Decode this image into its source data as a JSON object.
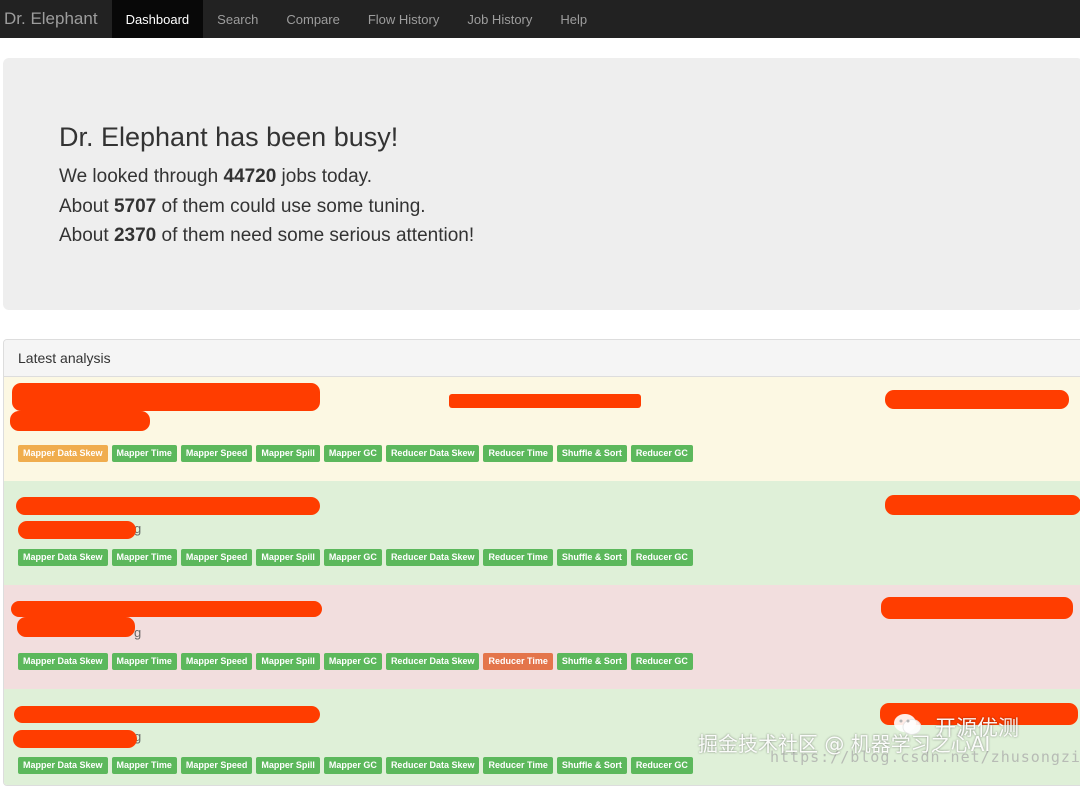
{
  "nav": {
    "brand": "Dr. Elephant",
    "items": [
      "Dashboard",
      "Search",
      "Compare",
      "Flow History",
      "Job History",
      "Help"
    ],
    "active": "Dashboard"
  },
  "jumbotron": {
    "title": "Dr. Elephant has been busy!",
    "line1": {
      "pre": "We looked through ",
      "num": "44720",
      "post": " jobs today."
    },
    "line2": {
      "pre": "About ",
      "num": "5707",
      "post": " of them could use some tuning."
    },
    "line3": {
      "pre": "About ",
      "num": "2370",
      "post": " of them need some serious attention!"
    }
  },
  "panel": {
    "heading": "Latest analysis",
    "rows": [
      {
        "status": "warning",
        "trailing_text": "",
        "badges": [
          {
            "label": "Mapper Data Skew",
            "severity": "moderate"
          },
          {
            "label": "Mapper Time",
            "severity": "none"
          },
          {
            "label": "Mapper Speed",
            "severity": "none"
          },
          {
            "label": "Mapper Spill",
            "severity": "none"
          },
          {
            "label": "Mapper GC",
            "severity": "none"
          },
          {
            "label": "Reducer Data Skew",
            "severity": "none"
          },
          {
            "label": "Reducer Time",
            "severity": "none"
          },
          {
            "label": "Shuffle & Sort",
            "severity": "none"
          },
          {
            "label": "Reducer GC",
            "severity": "none"
          }
        ]
      },
      {
        "status": "success",
        "trailing_text": "g",
        "badges": [
          {
            "label": "Mapper Data Skew",
            "severity": "none"
          },
          {
            "label": "Mapper Time",
            "severity": "none"
          },
          {
            "label": "Mapper Speed",
            "severity": "none"
          },
          {
            "label": "Mapper Spill",
            "severity": "none"
          },
          {
            "label": "Mapper GC",
            "severity": "none"
          },
          {
            "label": "Reducer Data Skew",
            "severity": "none"
          },
          {
            "label": "Reducer Time",
            "severity": "none"
          },
          {
            "label": "Shuffle & Sort",
            "severity": "none"
          },
          {
            "label": "Reducer GC",
            "severity": "none"
          }
        ]
      },
      {
        "status": "danger",
        "trailing_text": "g",
        "badges": [
          {
            "label": "Mapper Data Skew",
            "severity": "none"
          },
          {
            "label": "Mapper Time",
            "severity": "none"
          },
          {
            "label": "Mapper Speed",
            "severity": "none"
          },
          {
            "label": "Mapper Spill",
            "severity": "none"
          },
          {
            "label": "Mapper GC",
            "severity": "none"
          },
          {
            "label": "Reducer Data Skew",
            "severity": "none"
          },
          {
            "label": "Reducer Time",
            "severity": "severe"
          },
          {
            "label": "Shuffle & Sort",
            "severity": "none"
          },
          {
            "label": "Reducer GC",
            "severity": "none"
          }
        ]
      },
      {
        "status": "success",
        "trailing_text": "g",
        "badges": [
          {
            "label": "Mapper Data Skew",
            "severity": "none"
          },
          {
            "label": "Mapper Time",
            "severity": "none"
          },
          {
            "label": "Mapper Speed",
            "severity": "none"
          },
          {
            "label": "Mapper Spill",
            "severity": "none"
          },
          {
            "label": "Mapper GC",
            "severity": "none"
          },
          {
            "label": "Reducer Data Skew",
            "severity": "none"
          },
          {
            "label": "Reducer Time",
            "severity": "none"
          },
          {
            "label": "Shuffle & Sort",
            "severity": "none"
          },
          {
            "label": "Reducer GC",
            "severity": "none"
          }
        ]
      }
    ]
  },
  "colors": {
    "navbar": "#222222",
    "redaction": "#ff3d00",
    "severity_none": "#5cb85c",
    "severity_moderate": "#f0ad4e",
    "severity_severe": "#e4754b",
    "row_warning": "#fcf8e3",
    "row_success": "#dff0d8",
    "row_danger": "#f2dede"
  },
  "watermark": {
    "url": "https://blog.csdn.net/zhusongziye",
    "community": "掘金技术社区 @ 机器学习之心AI",
    "brand": "开源优测",
    "icon": "wechat-icon"
  }
}
